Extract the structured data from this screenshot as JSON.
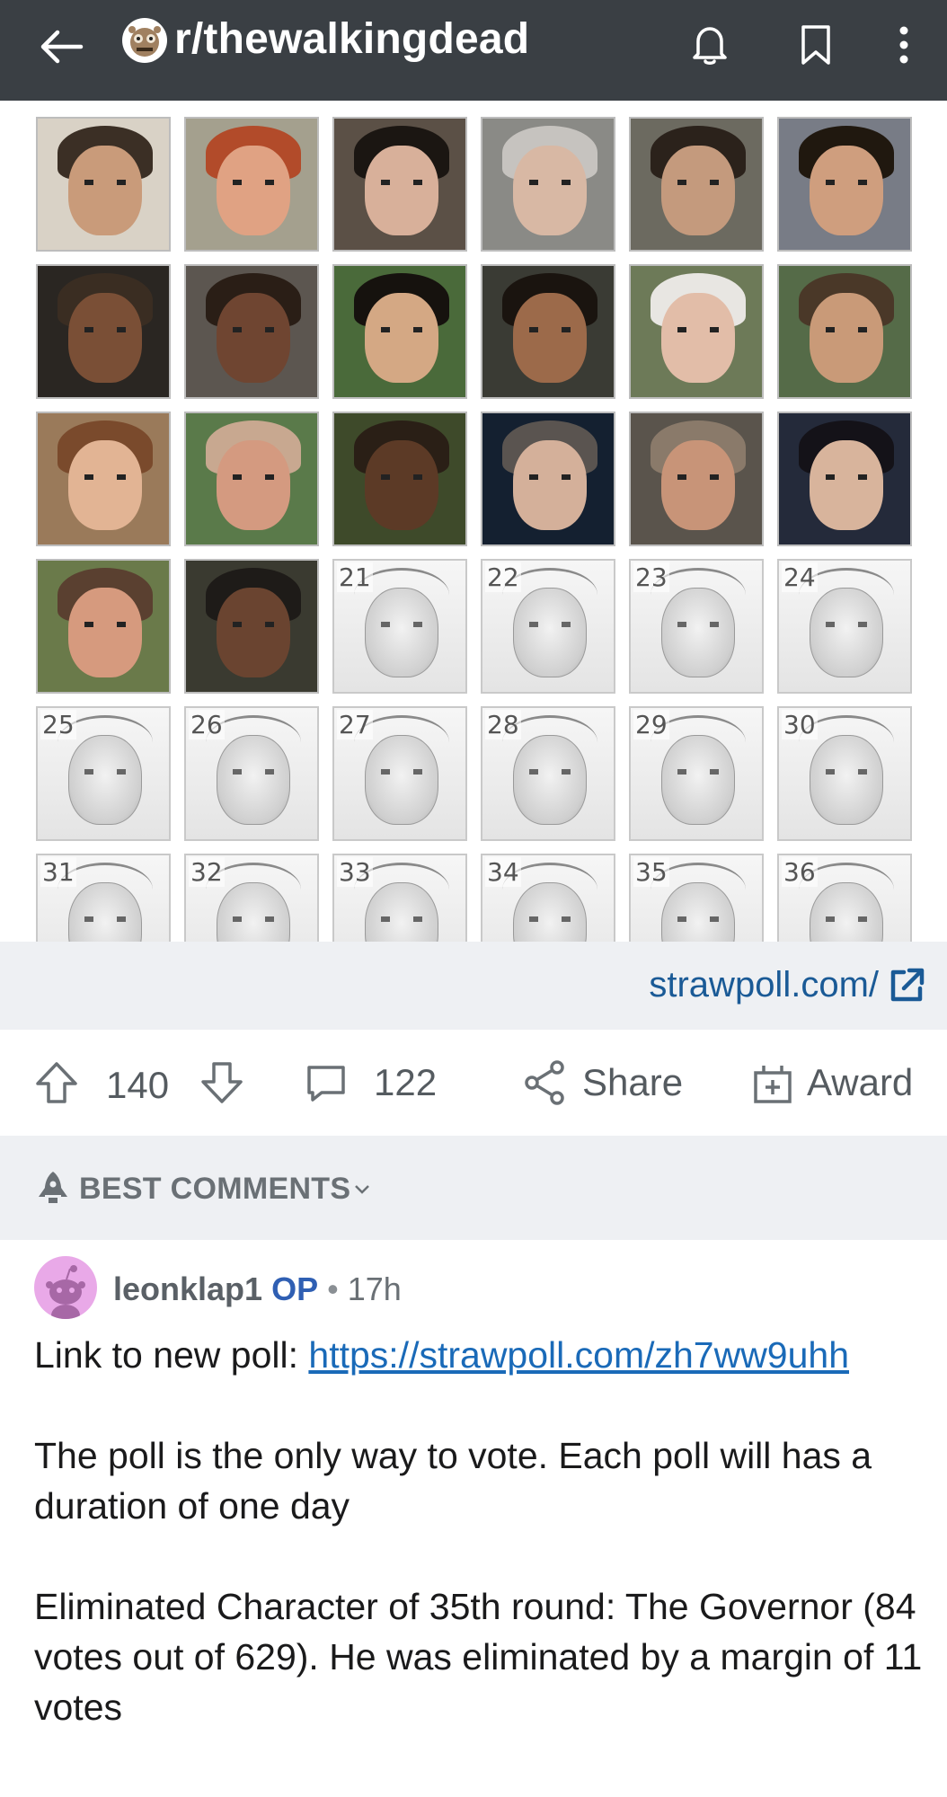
{
  "header": {
    "subreddit": "r/thewalkingdead",
    "back_icon": "arrow-left-icon",
    "bell_icon": "bell-icon",
    "bookmark_icon": "bookmark-icon",
    "more_icon": "more-vertical-icon"
  },
  "media": {
    "tiles": [
      {
        "label": "",
        "style": "photo",
        "skin": "#c99b7a",
        "hair": "#3b2f25",
        "bg": "#d9d2c6"
      },
      {
        "label": "",
        "style": "photo",
        "skin": "#e0a283",
        "hair": "#b24b2a",
        "bg": "#a4a08e"
      },
      {
        "label": "",
        "style": "photo",
        "skin": "#d8b09a",
        "hair": "#1b1612",
        "bg": "#5b5046"
      },
      {
        "label": "",
        "style": "photo",
        "skin": "#d8b8a4",
        "hair": "#c6c3bf",
        "bg": "#8a8a86"
      },
      {
        "label": "",
        "style": "photo",
        "skin": "#c49a7d",
        "hair": "#2b221b",
        "bg": "#6c6a60"
      },
      {
        "label": "",
        "style": "photo",
        "skin": "#cf9e7e",
        "hair": "#20180f",
        "bg": "#787c86"
      },
      {
        "label": "",
        "style": "photo",
        "skin": "#7a4f36",
        "hair": "#3a2d22",
        "bg": "#2a2622"
      },
      {
        "label": "",
        "style": "photo",
        "skin": "#6f4531",
        "hair": "#2a1e16",
        "bg": "#5c5650"
      },
      {
        "label": "",
        "style": "photo",
        "skin": "#d4a884",
        "hair": "#16120e",
        "bg": "#4a6a3a"
      },
      {
        "label": "",
        "style": "photo",
        "skin": "#9c6a4a",
        "hair": "#1a140f",
        "bg": "#3a3b34"
      },
      {
        "label": "",
        "style": "photo",
        "skin": "#e2bda8",
        "hair": "#e8e6e2",
        "bg": "#6d7a58"
      },
      {
        "label": "",
        "style": "photo",
        "skin": "#c99a78",
        "hair": "#4a3828",
        "bg": "#556b48"
      },
      {
        "label": "",
        "style": "photo",
        "skin": "#e2b494",
        "hair": "#7a4a2c",
        "bg": "#9a7a5a"
      },
      {
        "label": "",
        "style": "photo",
        "skin": "#d49a80",
        "hair": "#c8a890",
        "bg": "#5a7a4a"
      },
      {
        "label": "",
        "style": "photo",
        "skin": "#5c3a26",
        "hair": "#2a1f16",
        "bg": "#3e4a2a"
      },
      {
        "label": "",
        "style": "photo",
        "skin": "#d4b09a",
        "hair": "#5a5450",
        "bg": "#142030"
      },
      {
        "label": "",
        "style": "photo",
        "skin": "#c89478",
        "hair": "#8a7a6a",
        "bg": "#5a544c"
      },
      {
        "label": "",
        "style": "photo",
        "skin": "#d8b49c",
        "hair": "#141218",
        "bg": "#242a3a"
      },
      {
        "label": "",
        "style": "photo",
        "skin": "#d69a7e",
        "hair": "#5a4030",
        "bg": "#6a7a4a"
      },
      {
        "label": "",
        "style": "photo",
        "skin": "#6a4430",
        "hair": "#1e1b18",
        "bg": "#3a3a30"
      },
      {
        "label": "21",
        "style": "sketch"
      },
      {
        "label": "22",
        "style": "sketch"
      },
      {
        "label": "23",
        "style": "sketch"
      },
      {
        "label": "24",
        "style": "sketch"
      },
      {
        "label": "25",
        "style": "sketch"
      },
      {
        "label": "26",
        "style": "sketch"
      },
      {
        "label": "27",
        "style": "sketch"
      },
      {
        "label": "28",
        "style": "sketch"
      },
      {
        "label": "29",
        "style": "sketch"
      },
      {
        "label": "30",
        "style": "sketch"
      },
      {
        "label": "31",
        "style": "sketch"
      },
      {
        "label": "32",
        "style": "sketch"
      },
      {
        "label": "33",
        "style": "sketch"
      },
      {
        "label": "34",
        "style": "sketch"
      },
      {
        "label": "35",
        "style": "sketch"
      },
      {
        "label": "36",
        "style": "sketch"
      }
    ]
  },
  "link": {
    "text": "strawpoll.com/",
    "icon": "external-link-icon"
  },
  "actions": {
    "upvote_icon": "upvote-arrow-icon",
    "score": "140",
    "downvote_icon": "downvote-arrow-icon",
    "comment_icon": "comment-bubble-icon",
    "comments_count": "122",
    "share_icon": "share-icon",
    "share_label": "Share",
    "award_icon": "gift-icon",
    "award_label": "Award"
  },
  "sort": {
    "icon": "rocket-icon",
    "label": "BEST COMMENTS",
    "chevron": "chevron-down-icon"
  },
  "comment": {
    "username": "leonklap1",
    "op_badge": "OP",
    "separator": "•",
    "time": "17h",
    "line1_prefix": "Link to new poll: ",
    "link_text": "https://strawpoll.com/zh7ww9uhh",
    "paragraph2": "The poll is the only way to vote. Each poll will has a duration of one day",
    "paragraph3": "Eliminated Character of 35th round: The Governor (84 votes out of 629). He was eliminated by a margin of 11 votes"
  },
  "colors": {
    "header_bg": "#3a3f44",
    "link_blue": "#1a5a96",
    "op_blue": "#2f5fb3",
    "band_bg": "#eef0f3",
    "avatar_pink": "#e9a9e8"
  }
}
